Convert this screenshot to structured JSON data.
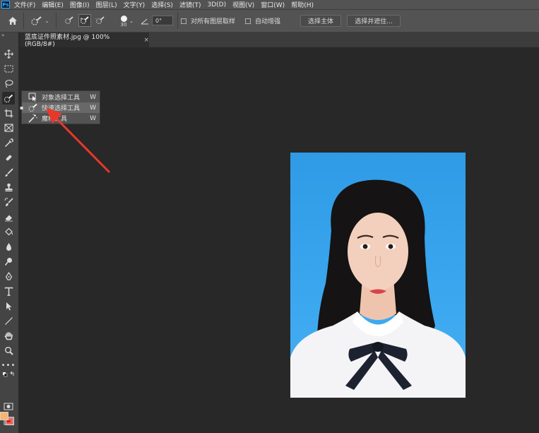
{
  "app": {
    "logo_text": "Ps"
  },
  "menu": [
    "文件(F)",
    "编辑(E)",
    "图像(I)",
    "图层(L)",
    "文字(Y)",
    "选择(S)",
    "滤镜(T)",
    "3D(D)",
    "视图(V)",
    "窗口(W)",
    "帮助(H)"
  ],
  "options": {
    "brush_size": "30",
    "angle_value": "0°",
    "sample_all_layers_label": "对所有图层取样",
    "auto_enhance_label": "自动增强",
    "select_subject_label": "选择主体",
    "select_and_mask_label": "选择并遮住..."
  },
  "document_tab": {
    "title": "蓝底证件照素材.jpg @ 100%(RGB/8#)",
    "close": "×"
  },
  "flyout": [
    {
      "label": "对象选择工具",
      "shortcut": "W"
    },
    {
      "label": "快速选择工具",
      "shortcut": "W"
    },
    {
      "label": "魔棒工具",
      "shortcut": "W"
    }
  ],
  "colors": {
    "foreground": "#f9b46b",
    "background": "#e51b12",
    "photo_background": "#3aa7ef",
    "annotation_arrow": "#e8382b"
  },
  "tools": [
    "move-icon",
    "marquee-icon",
    "lasso-icon",
    "quick-select-icon",
    "crop-icon",
    "frame-icon",
    "eyedropper-icon",
    "healing-brush-icon",
    "brush-icon",
    "clone-stamp-icon",
    "history-brush-icon",
    "eraser-icon",
    "paint-bucket-icon",
    "blur-icon",
    "dodge-icon",
    "pen-icon",
    "type-icon",
    "path-select-icon",
    "line-icon",
    "hand-icon",
    "zoom-icon",
    "more-tools-icon"
  ]
}
